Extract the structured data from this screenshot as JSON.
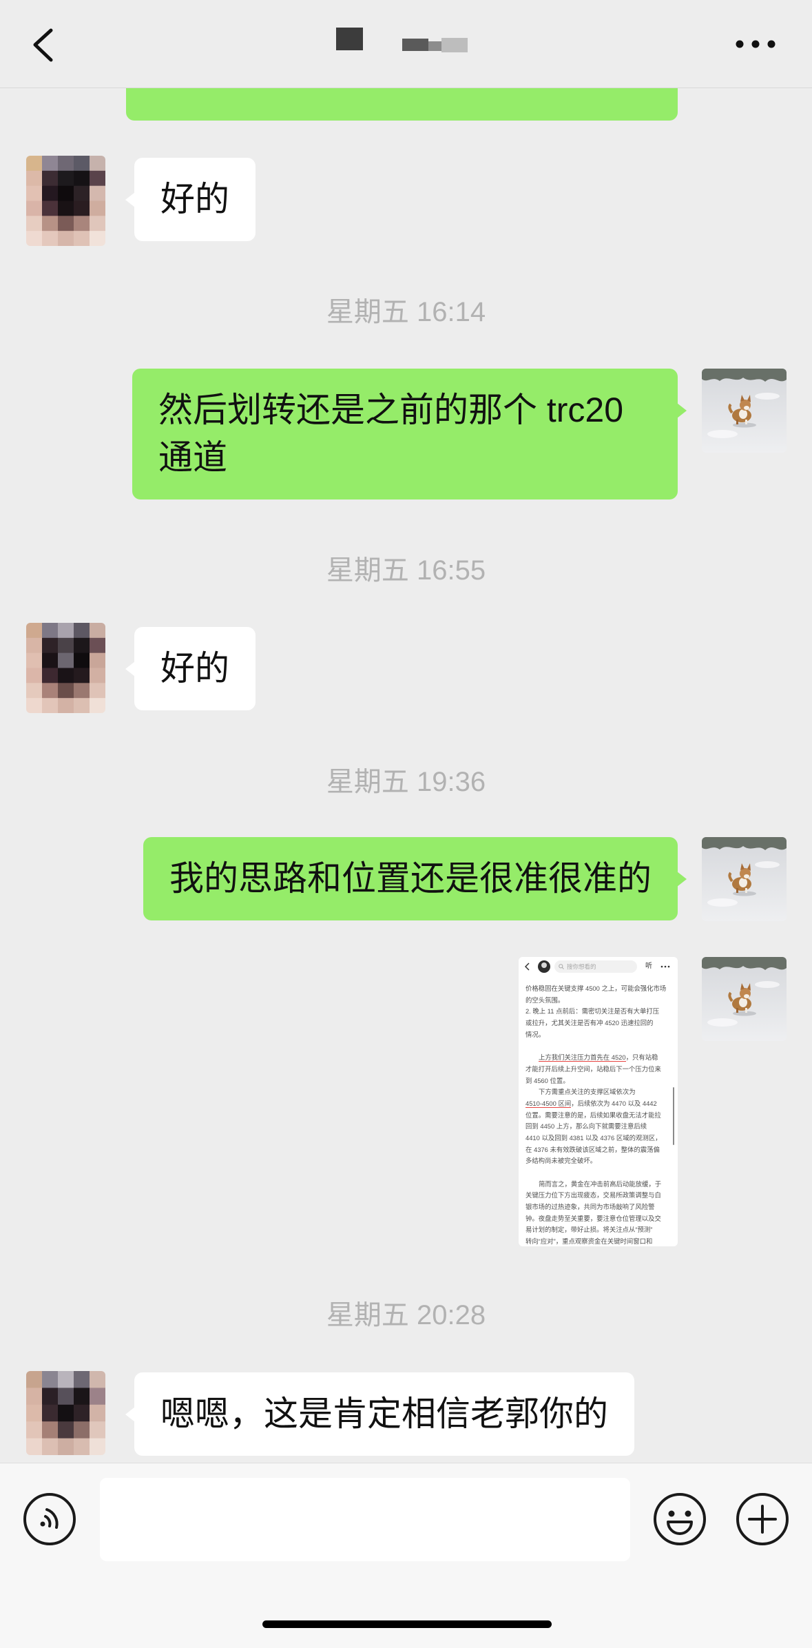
{
  "colors": {
    "chat_bg": "#ededed",
    "sent_bubble": "#95ec69",
    "received_bubble": "#ffffff",
    "timestamp": "#b2b2b2",
    "input_bar": "#f7f7f7",
    "underline": "#e64340"
  },
  "header": {
    "back_icon": "chevron-left-icon",
    "more_icon": "more-dots-icon"
  },
  "timestamps": [
    "星期五 16:14",
    "星期五 16:55",
    "星期五 19:36",
    "星期五 20:28"
  ],
  "messages": [
    {
      "text": "好的"
    },
    {
      "text": "然后划转还是之前的那个 trc20 通道"
    },
    {
      "text": "好的"
    },
    {
      "text": "我的思路和位置还是很准很准的"
    },
    {
      "text": "嗯嗯，这是肯定相信老郭你的"
    }
  ],
  "image_message": {
    "nav": {
      "search_placeholder": "搜你想看的",
      "listen_label": "听"
    },
    "lines": [
      {
        "text": "价格稳固在关键支撑 4500 之上，可能会强化市场"
      },
      {
        "text": "的空头氛围。"
      },
      {
        "text": "2. 晚上 11 点前后：需密切关注是否有大单打压"
      },
      {
        "text": "或拉升，尤其关注是否有冲 4520 迅速拉回的"
      },
      {
        "text": "情况。"
      },
      {
        "text": ""
      },
      {
        "text": "上方我们关注压力首先在 4520，只有站稳",
        "underline": "上方我们关注压力首先在 4520"
      },
      {
        "text": "才能打开后续上升空间，站稳后下一个压力位来"
      },
      {
        "text": "到 4560 位置。"
      },
      {
        "text": "下方需重点关注的支撑区域依次为"
      },
      {
        "text": "4510-4500 区间，后续依次为 4470 以及 4442",
        "underline": "4510-4500 区间"
      },
      {
        "text": "位置。需要注意的是，后续如果收盘无法才能拉"
      },
      {
        "text": "回到 4450 上方，那么向下就需要注意后续"
      },
      {
        "text": "4410 以及回到 4381 以及 4376 区域的观测区，"
      },
      {
        "text": "在 4376 未有效跌破该区域之前，整体的震荡偏"
      },
      {
        "text": "多结构尚未被完全破坏。"
      },
      {
        "text": ""
      },
      {
        "text": "简而言之，黄金在冲击前高后动能放缓，于"
      },
      {
        "text": "关键压力位下方出现疲态，交易所政策调整与白"
      },
      {
        "text": "银市场的过热迹象，共同为市场敲响了风险警"
      },
      {
        "text": "钟。夜盘走势至关重要，要注意仓位管理以及交"
      },
      {
        "text": "易计划的制定，带好止损。将关注点从“预测”"
      },
      {
        "text": "转向“应对”，重点观察资金在关键时间窗口和"
      }
    ]
  },
  "input_bar": {
    "voice_icon": "voice-icon",
    "emoji_icon": "emoji-icon",
    "plus_icon": "plus-icon",
    "input_value": ""
  }
}
